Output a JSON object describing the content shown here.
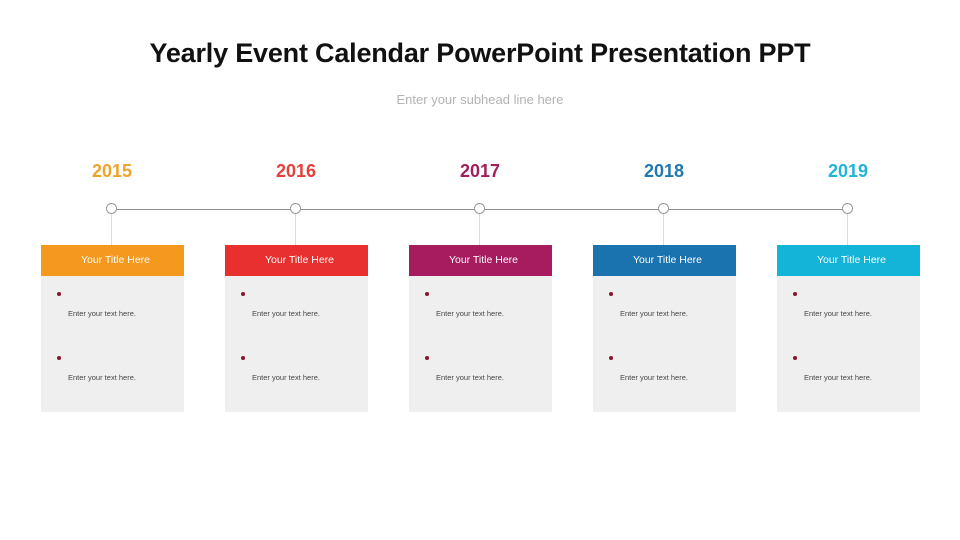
{
  "slide": {
    "title": "Yearly Event Calendar PowerPoint Presentation PPT",
    "subhead": "Enter your subhead line here",
    "background_color": "#FFFFFF",
    "axis_color": "#8F8F8F",
    "card_body_color": "#EFEFEF",
    "bullet_color": "#8C1230"
  },
  "timeline": {
    "nodes": [
      {
        "year": "2015",
        "year_color": "#F0A32A",
        "accent_color": "#F5981E",
        "card": {
          "title": "Your Title Here",
          "bullets": [
            {
              "text": "Enter your text here."
            },
            {
              "text": "Enter your text here."
            }
          ]
        }
      },
      {
        "year": "2016",
        "year_color": "#E5403C",
        "accent_color": "#E8312F",
        "card": {
          "title": "Your Title Here",
          "bullets": [
            {
              "text": "Enter your text here."
            },
            {
              "text": "Enter your text here."
            }
          ]
        }
      },
      {
        "year": "2017",
        "year_color": "#A2205C",
        "accent_color": "#A61C5F",
        "card": {
          "title": "Your Title Here",
          "bullets": [
            {
              "text": "Enter your text here."
            },
            {
              "text": "Enter your text here."
            }
          ]
        }
      },
      {
        "year": "2018",
        "year_color": "#2079B4",
        "accent_color": "#1A73AE",
        "card": {
          "title": "Your Title Here",
          "bullets": [
            {
              "text": "Enter your text here."
            },
            {
              "text": "Enter your text here."
            }
          ]
        }
      },
      {
        "year": "2019",
        "year_color": "#1FB5DA",
        "accent_color": "#14B3D8",
        "card": {
          "title": "Your Title Here",
          "bullets": [
            {
              "text": "Enter your text here."
            },
            {
              "text": "Enter your text here."
            }
          ]
        }
      }
    ]
  }
}
